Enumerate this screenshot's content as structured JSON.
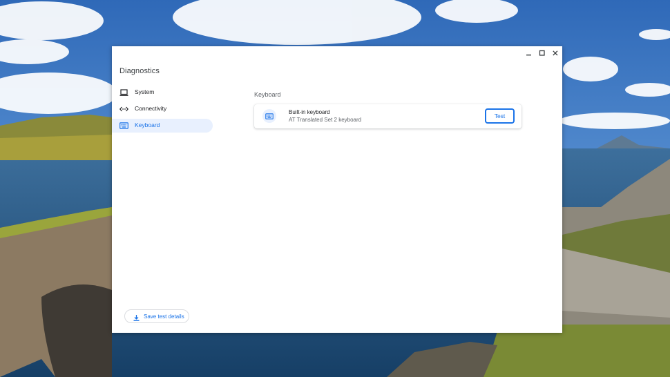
{
  "window": {
    "title": "Diagnostics",
    "controls": {
      "minimize_icon": "minimize-icon",
      "maximize_icon": "maximize-icon",
      "close_icon": "close-icon"
    }
  },
  "sidebar": {
    "items": [
      {
        "label": "System",
        "icon": "laptop-icon",
        "selected": false
      },
      {
        "label": "Connectivity",
        "icon": "code-arrows-icon",
        "selected": false
      },
      {
        "label": "Keyboard",
        "icon": "keyboard-icon",
        "selected": true
      }
    ]
  },
  "main": {
    "section_title": "Keyboard",
    "device": {
      "name": "Built-in keyboard",
      "description": "AT Translated Set 2 keyboard",
      "icon": "keyboard-icon",
      "test_label": "Test"
    }
  },
  "footer": {
    "save_label": "Save test details",
    "save_icon": "download-icon"
  },
  "colors": {
    "accent": "#1a73e8",
    "selected_bg": "#e8f0fe",
    "text_primary": "#202124",
    "text_secondary": "#5f6368"
  }
}
